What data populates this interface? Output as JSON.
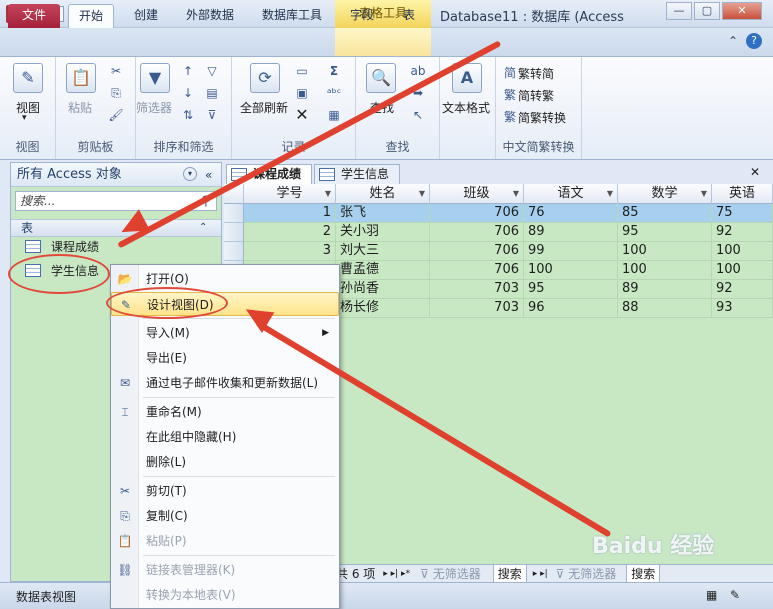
{
  "title_bar": {
    "app_icon": "A",
    "context_tab_title": "表格工具",
    "window_title": "Database11 : 数据库 (Access"
  },
  "tabs": [
    "文件",
    "开始",
    "创建",
    "外部数据",
    "数据库工具",
    "字段",
    "表"
  ],
  "ribbon": {
    "groups": [
      {
        "label": "视图",
        "buttons": [
          "视图"
        ]
      },
      {
        "label": "剪贴板",
        "buttons": [
          "粘贴"
        ]
      },
      {
        "label": "排序和筛选",
        "buttons": [
          "筛选器"
        ]
      },
      {
        "label": "记录",
        "buttons": [
          "全部刷新"
        ]
      },
      {
        "label": "查找",
        "buttons": [
          "查找"
        ]
      },
      {
        "label": "",
        "buttons": [
          "文本格式"
        ]
      },
      {
        "label": "中文简繁转换",
        "buttons": [
          "繁转简",
          "简转繁",
          "简繁转换"
        ]
      }
    ]
  },
  "nav_pane": {
    "header": "所有 Access 对象",
    "search_placeholder": "搜索...",
    "group": "表",
    "items": [
      "课程成绩",
      "学生信息"
    ]
  },
  "doc_tabs": [
    "课程成绩",
    "学生信息"
  ],
  "table": {
    "columns": [
      "学号",
      "姓名",
      "班级",
      "语文",
      "数学",
      "英语"
    ],
    "rows": [
      [
        "1",
        "张飞",
        "706",
        "76",
        "85",
        "75"
      ],
      [
        "2",
        "关小羽",
        "706",
        "89",
        "95",
        "92"
      ],
      [
        "3",
        "刘大三",
        "706",
        "99",
        "100",
        "100"
      ],
      [
        "",
        "曹孟德",
        "706",
        "100",
        "100",
        "100"
      ],
      [
        "",
        "孙尚香",
        "703",
        "95",
        "89",
        "92"
      ],
      [
        "",
        "杨长修",
        "703",
        "96",
        "88",
        "93"
      ]
    ]
  },
  "record_nav": {
    "count_text": "共 6 项",
    "filter1": "无筛选器",
    "search1": "搜索",
    "filter2": "无筛选器",
    "search2": "搜索"
  },
  "status_bar": {
    "left_text": "数据表视图"
  },
  "context_menu": {
    "items": [
      {
        "label": "打开(O)",
        "icon": "open-icon",
        "disabled": false
      },
      {
        "label": "设计视图(D)",
        "icon": "design-view-icon",
        "disabled": false,
        "highlighted": true
      },
      {
        "label": "导入(M)",
        "icon": "",
        "disabled": false,
        "submenu": true
      },
      {
        "label": "导出(E)",
        "icon": "",
        "disabled": false
      },
      {
        "label": "通过电子邮件收集和更新数据(L)",
        "icon": "email-icon",
        "disabled": false
      },
      {
        "label": "重命名(M)",
        "icon": "rename-icon",
        "disabled": false
      },
      {
        "label": "在此组中隐藏(H)",
        "icon": "",
        "disabled": false
      },
      {
        "label": "删除(L)",
        "icon": "",
        "disabled": false
      },
      {
        "label": "剪切(T)",
        "icon": "cut-icon",
        "disabled": false
      },
      {
        "label": "复制(C)",
        "icon": "copy-icon",
        "disabled": false
      },
      {
        "label": "粘贴(P)",
        "icon": "paste-icon",
        "disabled": true
      },
      {
        "label": "链接表管理器(K)",
        "icon": "linked-table-icon",
        "disabled": true
      },
      {
        "label": "转换为本地表(V)",
        "icon": "",
        "disabled": true
      }
    ]
  },
  "colors": {
    "annotation": "#e14a3a",
    "row_selected": "#a6d0ee",
    "grid_bg": "#c8e8c4"
  }
}
